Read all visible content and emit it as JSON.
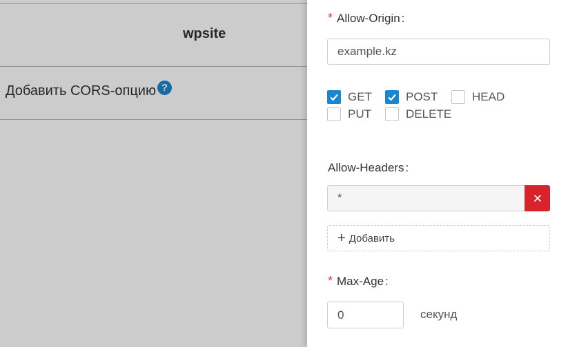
{
  "background": {
    "site_name": "wpsite",
    "add_cors_option": "Добавить CORS-опцию",
    "help_icon_glyph": "?"
  },
  "drawer": {
    "allow_origin": {
      "label": "Allow-Origin",
      "required_marker": "*",
      "colon": ":",
      "value": "example.kz"
    },
    "methods": [
      {
        "label": "GET",
        "checked": true
      },
      {
        "label": "POST",
        "checked": true
      },
      {
        "label": "HEAD",
        "checked": false
      },
      {
        "label": "PUT",
        "checked": false
      },
      {
        "label": "DELETE",
        "checked": false
      }
    ],
    "allow_headers": {
      "label": "Allow-Headers",
      "colon": ":",
      "items": [
        "*"
      ],
      "add_label": "Добавить",
      "add_icon": "plus-icon"
    },
    "max_age": {
      "label": "Max-Age",
      "required_marker": "*",
      "colon": ":",
      "value": "0",
      "unit": "секунд"
    }
  },
  "colors": {
    "accent": "#1a86d0",
    "danger": "#d8232a",
    "required": "#e53935"
  }
}
